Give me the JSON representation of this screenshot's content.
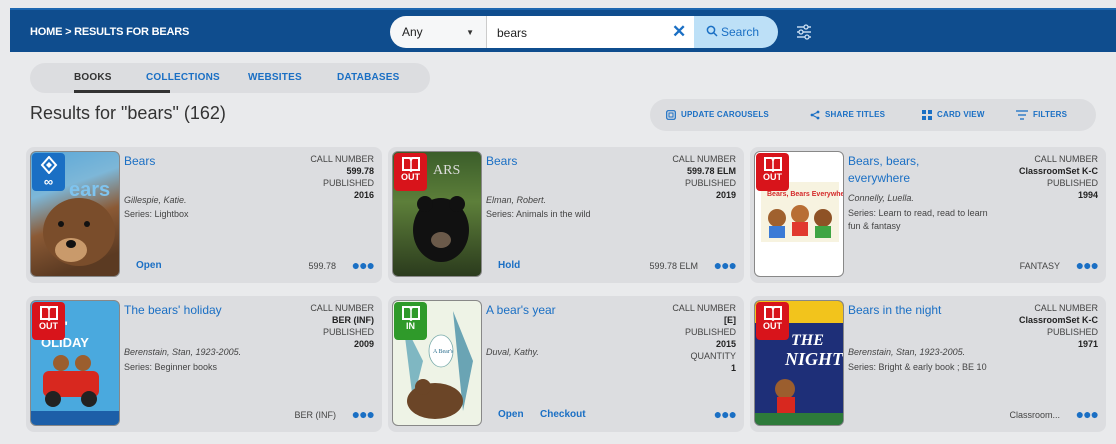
{
  "breadcrumb": {
    "home": "HOME",
    "sep": ">",
    "current": "RESULTS FOR BEARS"
  },
  "search": {
    "scope": "Any",
    "query": "bears",
    "button": "Search"
  },
  "tabs": [
    "BOOKS",
    "COLLECTIONS",
    "WEBSITES",
    "DATABASES"
  ],
  "results_heading": "Results for \"bears\" (162)",
  "actions": [
    "UPDATE CAROUSELS",
    "SHARE TITLES",
    "CARD VIEW",
    "FILTERS"
  ],
  "labels": {
    "call_number": "CALL NUMBER",
    "published": "PUBLISHED",
    "quantity": "QUANTITY"
  },
  "colors": {
    "header": "#0f4d8e",
    "link": "#1a6fc4",
    "out": "#d8141b",
    "in": "#2f9a2a",
    "ebook": "#1a6fc4"
  },
  "cards": [
    {
      "title": "Bears",
      "author": "Gillespie, Katie.",
      "series": "Series: Lightbox",
      "call_number": "599.78",
      "published": "2016",
      "status": "∞",
      "status_icon": "ebook-icon",
      "actions": [
        "Open"
      ],
      "call_bottom": "599.78"
    },
    {
      "title": "Bears",
      "author": "Elman, Robert.",
      "series": "Series: Animals in the wild",
      "call_number": "599.78 ELM",
      "published": "2019",
      "status": "OUT",
      "status_icon": "book-icon",
      "actions": [
        "Hold"
      ],
      "call_bottom": "599.78 ELM"
    },
    {
      "title": "Bears, bears, everywhere",
      "author": "Connelly, Luella.",
      "series": "Series: Learn to read, read to learn fun & fantasy",
      "call_number": "ClassroomSet K-C",
      "published": "1994",
      "status": "OUT",
      "status_icon": "book-icon",
      "actions": [],
      "call_bottom": "FANTASY"
    },
    {
      "title": "The bears' holiday",
      "author": "Berenstain, Stan, 1923-2005.",
      "series": "Series: Beginner books",
      "call_number": "BER (INF)",
      "published": "2009",
      "status": "OUT",
      "status_icon": "book-icon",
      "actions": [],
      "call_bottom": "BER (INF)"
    },
    {
      "title": "A bear's year",
      "author": "Duval, Kathy.",
      "series": "",
      "call_number": "[E]",
      "published": "2015",
      "quantity": "1",
      "status": "IN",
      "status_icon": "book-icon",
      "actions": [
        "Open",
        "Checkout"
      ],
      "call_bottom": ""
    },
    {
      "title": "Bears in the night",
      "author": "Berenstain, Stan, 1923-2005.",
      "series": "Series: Bright & early book ; BE 10",
      "call_number": "ClassroomSet K-C",
      "published": "1971",
      "status": "OUT",
      "status_icon": "book-icon",
      "actions": [],
      "call_bottom": "Classroom..."
    }
  ]
}
